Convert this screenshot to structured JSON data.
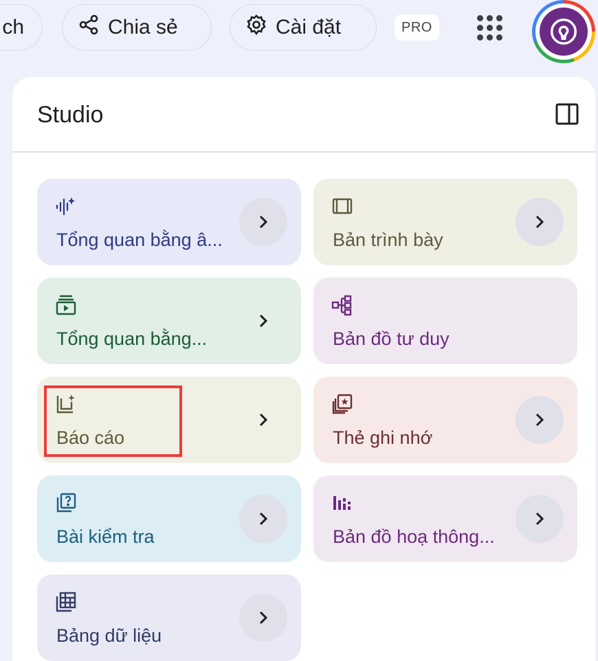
{
  "topbar": {
    "cut_label": "ch",
    "share_label": "Chia sẻ",
    "settings_label": "Cài đặt",
    "pro_badge": "PRO",
    "icons": [
      "share-icon",
      "gear-icon",
      "apps-grid-icon",
      "avatar-bulb-icon"
    ]
  },
  "panel": {
    "title": "Studio",
    "toggle_icon": "panel-toggle-icon"
  },
  "cards": [
    {
      "label": "Tổng quan bằng â...",
      "icon": "audio-sparkle-icon",
      "color": "#e8e9f8"
    },
    {
      "label": "Bản trình bày",
      "icon": "slides-icon",
      "color": "#f0efe4"
    },
    {
      "label": "Tổng quan bằng...",
      "icon": "video-icon",
      "color": "#e1efe6"
    },
    {
      "label": "Bản đồ tư duy",
      "icon": "mind-map-icon",
      "color": "#f0e8f1"
    },
    {
      "label": "Báo cáo",
      "icon": "report-icon",
      "color": "#f1f0e4"
    },
    {
      "label": "Thẻ ghi nhớ",
      "icon": "flashcard-icon",
      "color": "#f8e9e9"
    },
    {
      "label": "Bài kiểm tra",
      "icon": "quiz-icon",
      "color": "#dcedf4"
    },
    {
      "label": "Bản đồ hoạ thông...",
      "icon": "infographic-icon",
      "color": "#f0e8f1"
    },
    {
      "label": "Bảng dữ liệu",
      "icon": "data-table-icon",
      "color": "#e8e9f5"
    }
  ],
  "highlight_color": "#ef3b3b"
}
